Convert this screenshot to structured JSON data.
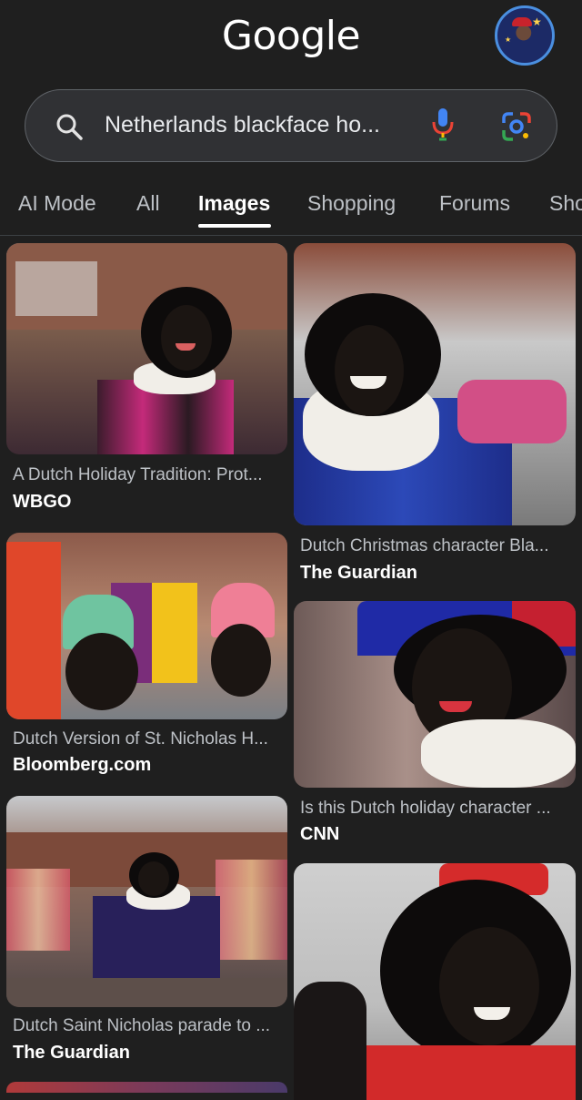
{
  "header": {
    "logo": "Google",
    "avatar_icon": "profile-avatar"
  },
  "search": {
    "query": "Netherlands blackface ho...",
    "icons": [
      "search-icon",
      "microphone-icon",
      "google-lens-icon"
    ]
  },
  "tabs": [
    {
      "label": "AI Mode"
    },
    {
      "label": "All"
    },
    {
      "label": "Images",
      "active": true
    },
    {
      "label": "Shopping"
    },
    {
      "label": "Forums"
    },
    {
      "label": "Sho"
    }
  ],
  "results": [
    {
      "caption": "A Dutch Holiday Tradition: Prot...",
      "source": "WBGO"
    },
    {
      "caption": "Dutch Christmas character Bla...",
      "source": "The Guardian"
    },
    {
      "caption": "Dutch Version of St. Nicholas H...",
      "source": "Bloomberg.com"
    },
    {
      "caption": "Is this Dutch holiday character ...",
      "source": "CNN"
    },
    {
      "caption": "Dutch Saint Nicholas parade to ...",
      "source": "The Guardian"
    },
    {
      "caption": "",
      "source": ""
    }
  ],
  "colors": {
    "background": "#1f1f1f",
    "searchbar": "#303134",
    "accent_blue": "#4a8fe0"
  }
}
